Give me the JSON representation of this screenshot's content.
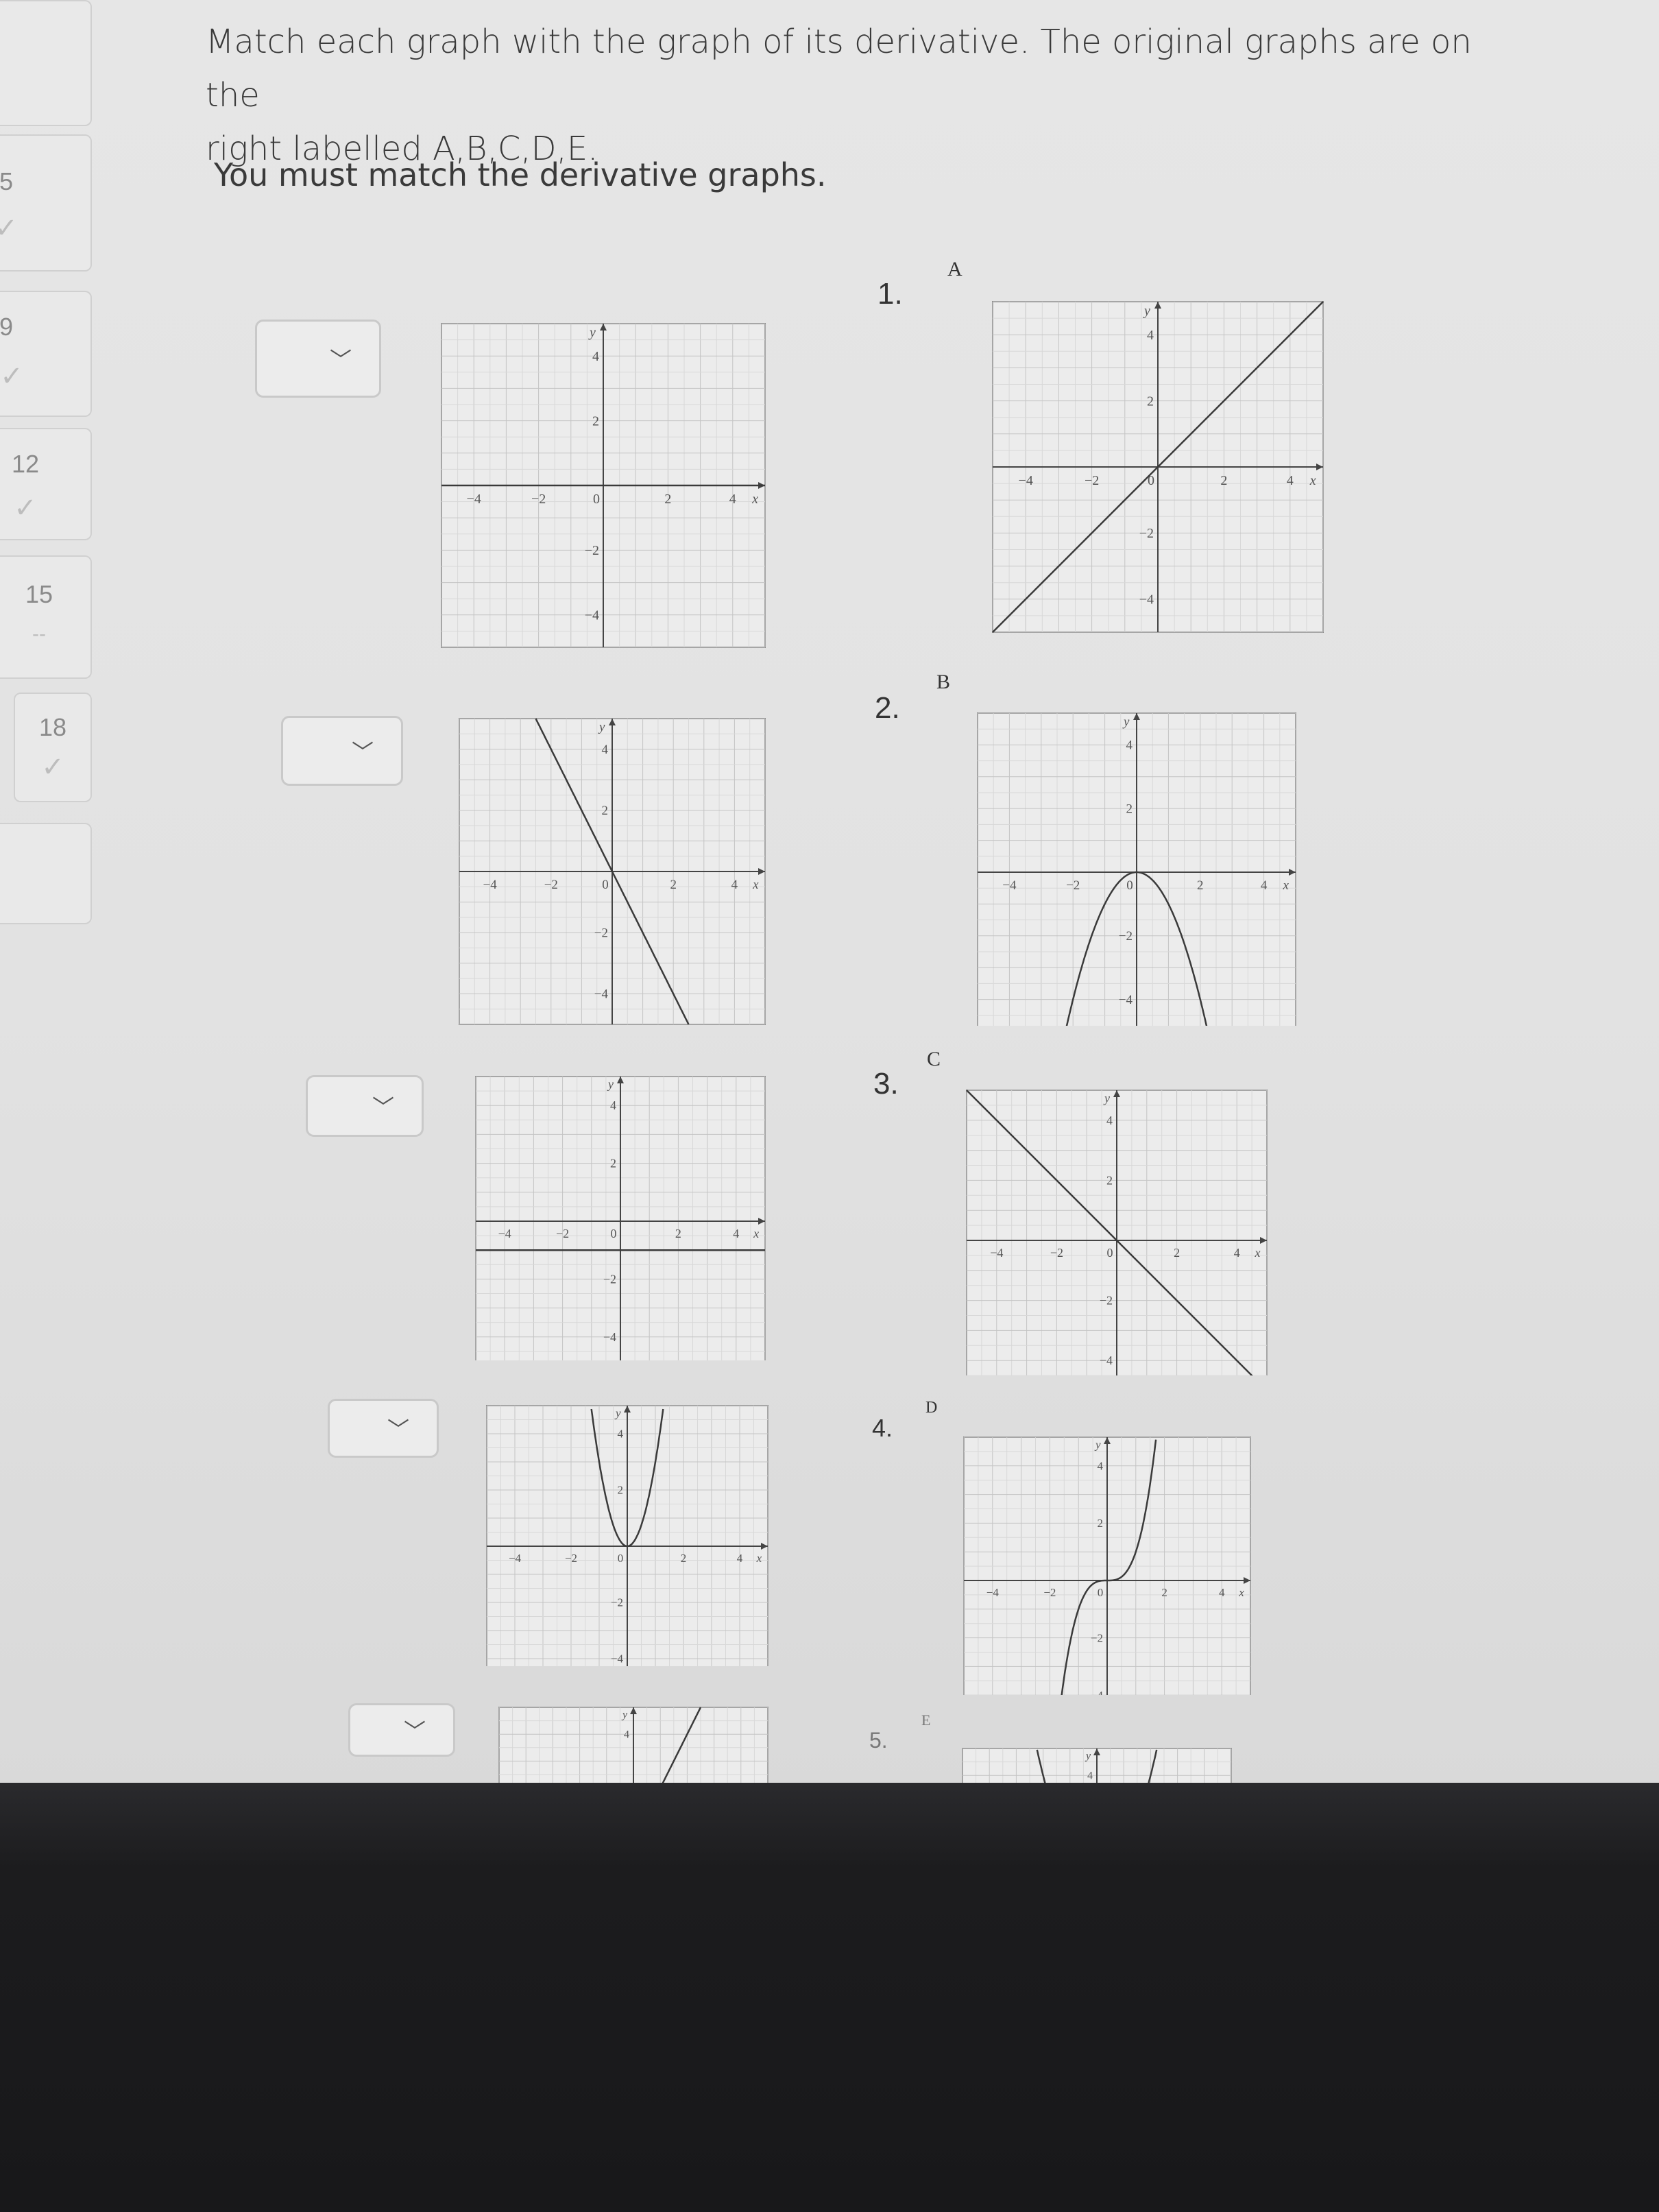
{
  "question": {
    "text_line1": "Match each graph with the graph of its derivative. The original graphs are on the",
    "text_line2": "right labelled A,B,C,D,E.",
    "note": "You must match the derivative graphs."
  },
  "sidebar": {
    "items": [
      {
        "number": "5",
        "status": "✓"
      },
      {
        "number": "9",
        "status": "✓"
      },
      {
        "number": "12",
        "status": "✓"
      },
      {
        "number": "15",
        "status": "--"
      },
      {
        "number": "18",
        "status": "✓"
      }
    ]
  },
  "dropdowns": [
    {
      "value": "",
      "chevron": "chevron-down-icon"
    },
    {
      "value": "",
      "chevron": "chevron-down-icon"
    },
    {
      "value": "",
      "chevron": "chevron-down-icon"
    },
    {
      "value": "",
      "chevron": "chevron-down-icon"
    },
    {
      "value": "",
      "chevron": "chevron-down-icon"
    }
  ],
  "numbers": [
    "1.",
    "2.",
    "3.",
    "4.",
    "5."
  ],
  "letters": [
    "A",
    "B",
    "C",
    "D",
    "E"
  ],
  "axis": {
    "xlabel": "x",
    "ylabel": "y",
    "ticks": [
      "−4",
      "−2",
      "0",
      "2",
      "4"
    ]
  },
  "chart_data": [
    {
      "type": "line",
      "name": "left-1",
      "function": "y = 0",
      "xlim": [
        -5,
        5
      ],
      "ylim": [
        -5,
        5
      ]
    },
    {
      "type": "line",
      "name": "left-2",
      "function": "y = -2x",
      "xlim": [
        -5,
        5
      ],
      "ylim": [
        -5,
        5
      ]
    },
    {
      "type": "line",
      "name": "left-3",
      "function": "y = -1",
      "xlim": [
        -5,
        5
      ],
      "ylim": [
        -5,
        5
      ]
    },
    {
      "type": "line",
      "name": "left-4",
      "function": "y = 3x^2",
      "xlim": [
        -5,
        5
      ],
      "ylim": [
        -5,
        5
      ]
    },
    {
      "type": "line",
      "name": "left-5",
      "function": "y = 2x",
      "xlim": [
        -5,
        5
      ],
      "ylim": [
        -5,
        5
      ]
    },
    {
      "type": "line",
      "name": "A",
      "function": "y = x",
      "xlim": [
        -5,
        5
      ],
      "ylim": [
        -5,
        5
      ]
    },
    {
      "type": "line",
      "name": "B",
      "function": "y = -x^2",
      "xlim": [
        -5,
        5
      ],
      "ylim": [
        -5,
        5
      ]
    },
    {
      "type": "line",
      "name": "C",
      "function": "y = -x",
      "xlim": [
        -5,
        5
      ],
      "ylim": [
        -5,
        5
      ]
    },
    {
      "type": "line",
      "name": "D",
      "function": "y = x^3",
      "xlim": [
        -5,
        5
      ],
      "ylim": [
        -5,
        5
      ]
    },
    {
      "type": "line",
      "name": "E",
      "function": "y = x^2",
      "xlim": [
        -5,
        5
      ],
      "ylim": [
        -5,
        5
      ]
    }
  ]
}
